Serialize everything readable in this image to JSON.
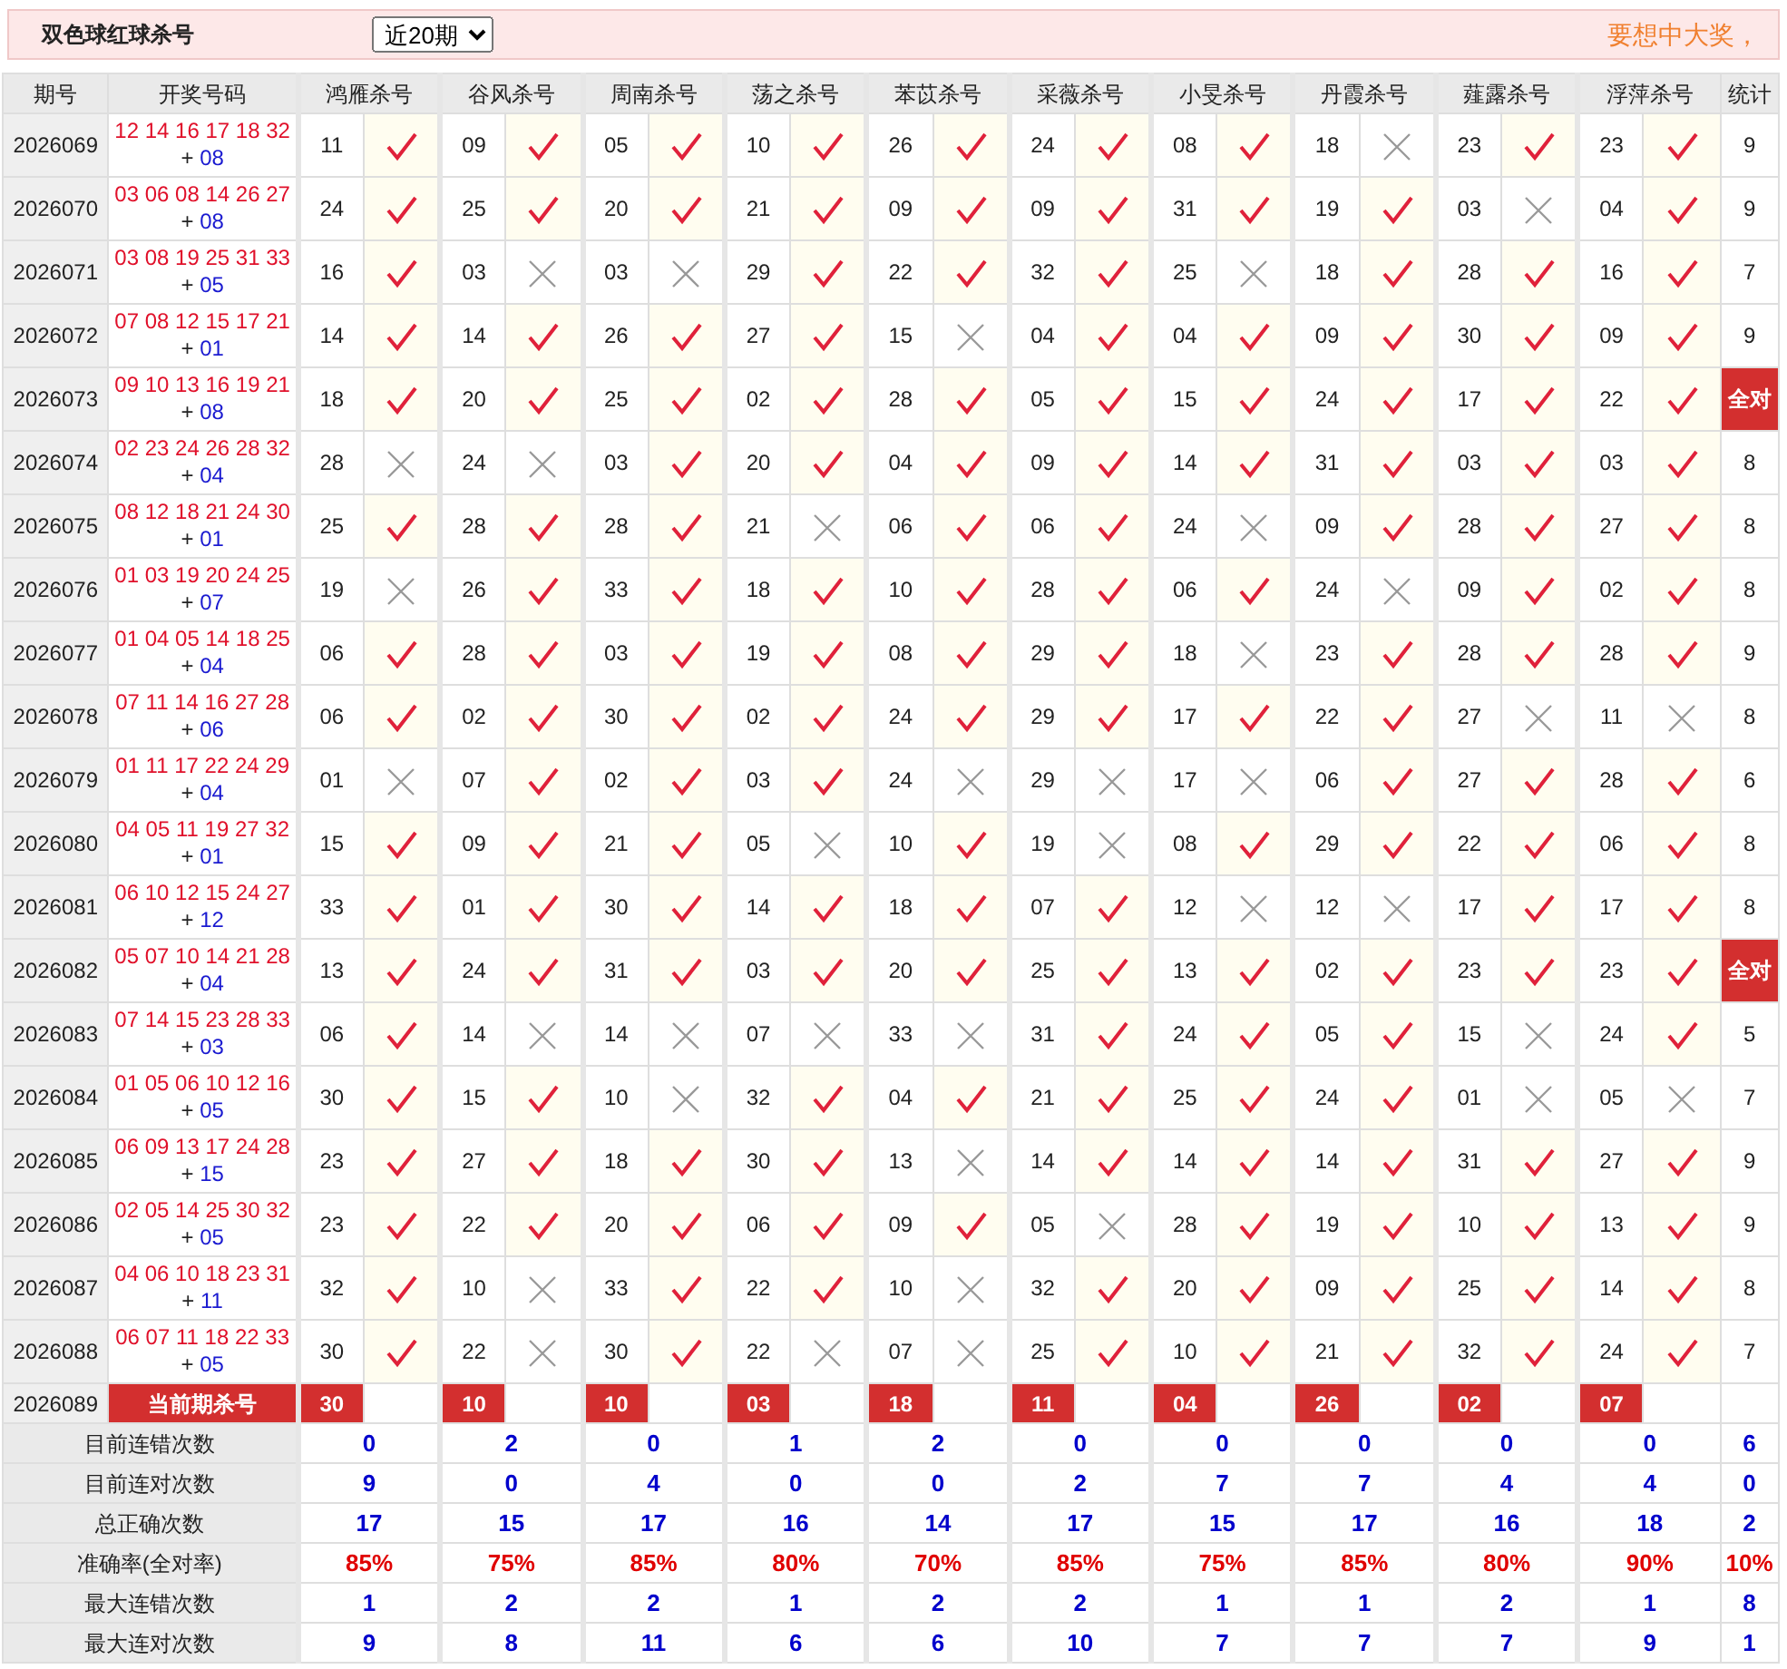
{
  "header": {
    "title": "双色球红球杀号",
    "period_select": {
      "value": "近20期"
    },
    "slogan": "要想中大奖，"
  },
  "table": {
    "columns": [
      "期号",
      "开奖号码",
      "鸿雁杀号",
      "谷风杀号",
      "周南杀号",
      "荡之杀号",
      "苯苡杀号",
      "采薇杀号",
      "小旻杀号",
      "丹霞杀号",
      "薤露杀号",
      "浮萍杀号",
      "统计"
    ],
    "rows": [
      {
        "period": "2026069",
        "reds": "12 14 16 17 18 32",
        "sign": "+",
        "blue": "08",
        "kills": [
          {
            "number": "11",
            "correct": true
          },
          {
            "number": "09",
            "correct": true
          },
          {
            "number": "05",
            "correct": true
          },
          {
            "number": "10",
            "correct": true
          },
          {
            "number": "26",
            "correct": true
          },
          {
            "number": "24",
            "correct": true
          },
          {
            "number": "08",
            "correct": true
          },
          {
            "number": "18",
            "correct": false
          },
          {
            "number": "23",
            "correct": true
          },
          {
            "number": "23",
            "correct": true
          }
        ],
        "tally": {
          "kind": "count",
          "text": "9"
        }
      },
      {
        "period": "2026070",
        "reds": "03 06 08 14 26 27",
        "sign": "+",
        "blue": "08",
        "kills": [
          {
            "number": "24",
            "correct": true
          },
          {
            "number": "25",
            "correct": true
          },
          {
            "number": "20",
            "correct": true
          },
          {
            "number": "21",
            "correct": true
          },
          {
            "number": "09",
            "correct": true
          },
          {
            "number": "09",
            "correct": true
          },
          {
            "number": "31",
            "correct": true
          },
          {
            "number": "19",
            "correct": true
          },
          {
            "number": "03",
            "correct": false
          },
          {
            "number": "04",
            "correct": true
          }
        ],
        "tally": {
          "kind": "count",
          "text": "9"
        }
      },
      {
        "period": "2026071",
        "reds": "03 08 19 25 31 33",
        "sign": "+",
        "blue": "05",
        "kills": [
          {
            "number": "16",
            "correct": true
          },
          {
            "number": "03",
            "correct": false
          },
          {
            "number": "03",
            "correct": false
          },
          {
            "number": "29",
            "correct": true
          },
          {
            "number": "22",
            "correct": true
          },
          {
            "number": "32",
            "correct": true
          },
          {
            "number": "25",
            "correct": false
          },
          {
            "number": "18",
            "correct": true
          },
          {
            "number": "28",
            "correct": true
          },
          {
            "number": "16",
            "correct": true
          }
        ],
        "tally": {
          "kind": "count",
          "text": "7"
        }
      },
      {
        "period": "2026072",
        "reds": "07 08 12 15 17 21",
        "sign": "+",
        "blue": "01",
        "kills": [
          {
            "number": "14",
            "correct": true
          },
          {
            "number": "14",
            "correct": true
          },
          {
            "number": "26",
            "correct": true
          },
          {
            "number": "27",
            "correct": true
          },
          {
            "number": "15",
            "correct": false
          },
          {
            "number": "04",
            "correct": true
          },
          {
            "number": "04",
            "correct": true
          },
          {
            "number": "09",
            "correct": true
          },
          {
            "number": "30",
            "correct": true
          },
          {
            "number": "09",
            "correct": true
          }
        ],
        "tally": {
          "kind": "count",
          "text": "9"
        }
      },
      {
        "period": "2026073",
        "reds": "09 10 13 16 19 21",
        "sign": "+",
        "blue": "08",
        "kills": [
          {
            "number": "18",
            "correct": true
          },
          {
            "number": "20",
            "correct": true
          },
          {
            "number": "25",
            "correct": true
          },
          {
            "number": "02",
            "correct": true
          },
          {
            "number": "28",
            "correct": true
          },
          {
            "number": "05",
            "correct": true
          },
          {
            "number": "15",
            "correct": true
          },
          {
            "number": "24",
            "correct": true
          },
          {
            "number": "17",
            "correct": true
          },
          {
            "number": "22",
            "correct": true
          }
        ],
        "tally": {
          "kind": "all_correct",
          "text": "全对"
        }
      },
      {
        "period": "2026074",
        "reds": "02 23 24 26 28 32",
        "sign": "+",
        "blue": "04",
        "kills": [
          {
            "number": "28",
            "correct": false
          },
          {
            "number": "24",
            "correct": false
          },
          {
            "number": "03",
            "correct": true
          },
          {
            "number": "20",
            "correct": true
          },
          {
            "number": "04",
            "correct": true
          },
          {
            "number": "09",
            "correct": true
          },
          {
            "number": "14",
            "correct": true
          },
          {
            "number": "31",
            "correct": true
          },
          {
            "number": "03",
            "correct": true
          },
          {
            "number": "03",
            "correct": true
          }
        ],
        "tally": {
          "kind": "count",
          "text": "8"
        }
      },
      {
        "period": "2026075",
        "reds": "08 12 18 21 24 30",
        "sign": "+",
        "blue": "01",
        "kills": [
          {
            "number": "25",
            "correct": true
          },
          {
            "number": "28",
            "correct": true
          },
          {
            "number": "28",
            "correct": true
          },
          {
            "number": "21",
            "correct": false
          },
          {
            "number": "06",
            "correct": true
          },
          {
            "number": "06",
            "correct": true
          },
          {
            "number": "24",
            "correct": false
          },
          {
            "number": "09",
            "correct": true
          },
          {
            "number": "28",
            "correct": true
          },
          {
            "number": "27",
            "correct": true
          }
        ],
        "tally": {
          "kind": "count",
          "text": "8"
        }
      },
      {
        "period": "2026076",
        "reds": "01 03 19 20 24 25",
        "sign": "+",
        "blue": "07",
        "kills": [
          {
            "number": "19",
            "correct": false
          },
          {
            "number": "26",
            "correct": true
          },
          {
            "number": "33",
            "correct": true
          },
          {
            "number": "18",
            "correct": true
          },
          {
            "number": "10",
            "correct": true
          },
          {
            "number": "28",
            "correct": true
          },
          {
            "number": "06",
            "correct": true
          },
          {
            "number": "24",
            "correct": false
          },
          {
            "number": "09",
            "correct": true
          },
          {
            "number": "02",
            "correct": true
          }
        ],
        "tally": {
          "kind": "count",
          "text": "8"
        }
      },
      {
        "period": "2026077",
        "reds": "01 04 05 14 18 25",
        "sign": "+",
        "blue": "04",
        "kills": [
          {
            "number": "06",
            "correct": true
          },
          {
            "number": "28",
            "correct": true
          },
          {
            "number": "03",
            "correct": true
          },
          {
            "number": "19",
            "correct": true
          },
          {
            "number": "08",
            "correct": true
          },
          {
            "number": "29",
            "correct": true
          },
          {
            "number": "18",
            "correct": false
          },
          {
            "number": "23",
            "correct": true
          },
          {
            "number": "28",
            "correct": true
          },
          {
            "number": "28",
            "correct": true
          }
        ],
        "tally": {
          "kind": "count",
          "text": "9"
        }
      },
      {
        "period": "2026078",
        "reds": "07 11 14 16 27 28",
        "sign": "+",
        "blue": "06",
        "kills": [
          {
            "number": "06",
            "correct": true
          },
          {
            "number": "02",
            "correct": true
          },
          {
            "number": "30",
            "correct": true
          },
          {
            "number": "02",
            "correct": true
          },
          {
            "number": "24",
            "correct": true
          },
          {
            "number": "29",
            "correct": true
          },
          {
            "number": "17",
            "correct": true
          },
          {
            "number": "22",
            "correct": true
          },
          {
            "number": "27",
            "correct": false
          },
          {
            "number": "11",
            "correct": false
          }
        ],
        "tally": {
          "kind": "count",
          "text": "8"
        }
      },
      {
        "period": "2026079",
        "reds": "01 11 17 22 24 29",
        "sign": "+",
        "blue": "04",
        "kills": [
          {
            "number": "01",
            "correct": false
          },
          {
            "number": "07",
            "correct": true
          },
          {
            "number": "02",
            "correct": true
          },
          {
            "number": "03",
            "correct": true
          },
          {
            "number": "24",
            "correct": false
          },
          {
            "number": "29",
            "correct": false
          },
          {
            "number": "17",
            "correct": false
          },
          {
            "number": "06",
            "correct": true
          },
          {
            "number": "27",
            "correct": true
          },
          {
            "number": "28",
            "correct": true
          }
        ],
        "tally": {
          "kind": "count",
          "text": "6"
        }
      },
      {
        "period": "2026080",
        "reds": "04 05 11 19 27 32",
        "sign": "+",
        "blue": "01",
        "kills": [
          {
            "number": "15",
            "correct": true
          },
          {
            "number": "09",
            "correct": true
          },
          {
            "number": "21",
            "correct": true
          },
          {
            "number": "05",
            "correct": false
          },
          {
            "number": "10",
            "correct": true
          },
          {
            "number": "19",
            "correct": false
          },
          {
            "number": "08",
            "correct": true
          },
          {
            "number": "29",
            "correct": true
          },
          {
            "number": "22",
            "correct": true
          },
          {
            "number": "06",
            "correct": true
          }
        ],
        "tally": {
          "kind": "count",
          "text": "8"
        }
      },
      {
        "period": "2026081",
        "reds": "06 10 12 15 24 27",
        "sign": "+",
        "blue": "12",
        "kills": [
          {
            "number": "33",
            "correct": true
          },
          {
            "number": "01",
            "correct": true
          },
          {
            "number": "30",
            "correct": true
          },
          {
            "number": "14",
            "correct": true
          },
          {
            "number": "18",
            "correct": true
          },
          {
            "number": "07",
            "correct": true
          },
          {
            "number": "12",
            "correct": false
          },
          {
            "number": "12",
            "correct": false
          },
          {
            "number": "17",
            "correct": true
          },
          {
            "number": "17",
            "correct": true
          }
        ],
        "tally": {
          "kind": "count",
          "text": "8"
        }
      },
      {
        "period": "2026082",
        "reds": "05 07 10 14 21 28",
        "sign": "+",
        "blue": "04",
        "kills": [
          {
            "number": "13",
            "correct": true
          },
          {
            "number": "24",
            "correct": true
          },
          {
            "number": "31",
            "correct": true
          },
          {
            "number": "03",
            "correct": true
          },
          {
            "number": "20",
            "correct": true
          },
          {
            "number": "25",
            "correct": true
          },
          {
            "number": "13",
            "correct": true
          },
          {
            "number": "02",
            "correct": true
          },
          {
            "number": "23",
            "correct": true
          },
          {
            "number": "23",
            "correct": true
          }
        ],
        "tally": {
          "kind": "all_correct",
          "text": "全对"
        }
      },
      {
        "period": "2026083",
        "reds": "07 14 15 23 28 33",
        "sign": "+",
        "blue": "03",
        "kills": [
          {
            "number": "06",
            "correct": true
          },
          {
            "number": "14",
            "correct": false
          },
          {
            "number": "14",
            "correct": false
          },
          {
            "number": "07",
            "correct": false
          },
          {
            "number": "33",
            "correct": false
          },
          {
            "number": "31",
            "correct": true
          },
          {
            "number": "24",
            "correct": true
          },
          {
            "number": "05",
            "correct": true
          },
          {
            "number": "15",
            "correct": false
          },
          {
            "number": "24",
            "correct": true
          }
        ],
        "tally": {
          "kind": "count",
          "text": "5"
        }
      },
      {
        "period": "2026084",
        "reds": "01 05 06 10 12 16",
        "sign": "+",
        "blue": "05",
        "kills": [
          {
            "number": "30",
            "correct": true
          },
          {
            "number": "15",
            "correct": true
          },
          {
            "number": "10",
            "correct": false
          },
          {
            "number": "32",
            "correct": true
          },
          {
            "number": "04",
            "correct": true
          },
          {
            "number": "21",
            "correct": true
          },
          {
            "number": "25",
            "correct": true
          },
          {
            "number": "24",
            "correct": true
          },
          {
            "number": "01",
            "correct": false
          },
          {
            "number": "05",
            "correct": false
          }
        ],
        "tally": {
          "kind": "count",
          "text": "7"
        }
      },
      {
        "period": "2026085",
        "reds": "06 09 13 17 24 28",
        "sign": "+",
        "blue": "15",
        "kills": [
          {
            "number": "23",
            "correct": true
          },
          {
            "number": "27",
            "correct": true
          },
          {
            "number": "18",
            "correct": true
          },
          {
            "number": "30",
            "correct": true
          },
          {
            "number": "13",
            "correct": false
          },
          {
            "number": "14",
            "correct": true
          },
          {
            "number": "14",
            "correct": true
          },
          {
            "number": "14",
            "correct": true
          },
          {
            "number": "31",
            "correct": true
          },
          {
            "number": "27",
            "correct": true
          }
        ],
        "tally": {
          "kind": "count",
          "text": "9"
        }
      },
      {
        "period": "2026086",
        "reds": "02 05 14 25 30 32",
        "sign": "+",
        "blue": "05",
        "kills": [
          {
            "number": "23",
            "correct": true
          },
          {
            "number": "22",
            "correct": true
          },
          {
            "number": "20",
            "correct": true
          },
          {
            "number": "06",
            "correct": true
          },
          {
            "number": "09",
            "correct": true
          },
          {
            "number": "05",
            "correct": false
          },
          {
            "number": "28",
            "correct": true
          },
          {
            "number": "19",
            "correct": true
          },
          {
            "number": "10",
            "correct": true
          },
          {
            "number": "13",
            "correct": true
          }
        ],
        "tally": {
          "kind": "count",
          "text": "9"
        }
      },
      {
        "period": "2026087",
        "reds": "04 06 10 18 23 31",
        "sign": "+",
        "blue": "11",
        "kills": [
          {
            "number": "32",
            "correct": true
          },
          {
            "number": "10",
            "correct": false
          },
          {
            "number": "33",
            "correct": true
          },
          {
            "number": "22",
            "correct": true
          },
          {
            "number": "10",
            "correct": false
          },
          {
            "number": "32",
            "correct": true
          },
          {
            "number": "20",
            "correct": true
          },
          {
            "number": "09",
            "correct": true
          },
          {
            "number": "25",
            "correct": true
          },
          {
            "number": "14",
            "correct": true
          }
        ],
        "tally": {
          "kind": "count",
          "text": "8"
        }
      },
      {
        "period": "2026088",
        "reds": "06 07 11 18 22 33",
        "sign": "+",
        "blue": "05",
        "kills": [
          {
            "number": "30",
            "correct": true
          },
          {
            "number": "22",
            "correct": false
          },
          {
            "number": "30",
            "correct": true
          },
          {
            "number": "22",
            "correct": false
          },
          {
            "number": "07",
            "correct": false
          },
          {
            "number": "25",
            "correct": true
          },
          {
            "number": "10",
            "correct": true
          },
          {
            "number": "21",
            "correct": true
          },
          {
            "number": "32",
            "correct": true
          },
          {
            "number": "24",
            "correct": true
          }
        ],
        "tally": {
          "kind": "count",
          "text": "7"
        }
      }
    ],
    "current": {
      "period": "2026089",
      "label": "当前期杀号",
      "kills": [
        "30",
        "10",
        "10",
        "03",
        "18",
        "11",
        "04",
        "26",
        "02",
        "07"
      ]
    },
    "stats": [
      {
        "label": "目前连错次数",
        "kind": "count",
        "values": [
          "0",
          "2",
          "0",
          "1",
          "2",
          "0",
          "0",
          "0",
          "0",
          "0",
          "6"
        ]
      },
      {
        "label": "目前连对次数",
        "kind": "count",
        "values": [
          "9",
          "0",
          "4",
          "0",
          "0",
          "2",
          "7",
          "7",
          "4",
          "4",
          "0"
        ]
      },
      {
        "label": "总正确次数",
        "kind": "count",
        "values": [
          "17",
          "15",
          "17",
          "16",
          "14",
          "17",
          "15",
          "17",
          "16",
          "18",
          "2"
        ]
      },
      {
        "label": "准确率(全对率)",
        "kind": "rate",
        "values": [
          "85%",
          "75%",
          "85%",
          "80%",
          "70%",
          "85%",
          "75%",
          "85%",
          "80%",
          "90%",
          "10%"
        ]
      },
      {
        "label": "最大连错次数",
        "kind": "count",
        "values": [
          "1",
          "2",
          "2",
          "1",
          "2",
          "2",
          "1",
          "1",
          "2",
          "1",
          "8"
        ]
      },
      {
        "label": "最大连对次数",
        "kind": "count",
        "values": [
          "9",
          "8",
          "11",
          "6",
          "6",
          "10",
          "7",
          "7",
          "7",
          "9",
          "1"
        ]
      }
    ]
  }
}
